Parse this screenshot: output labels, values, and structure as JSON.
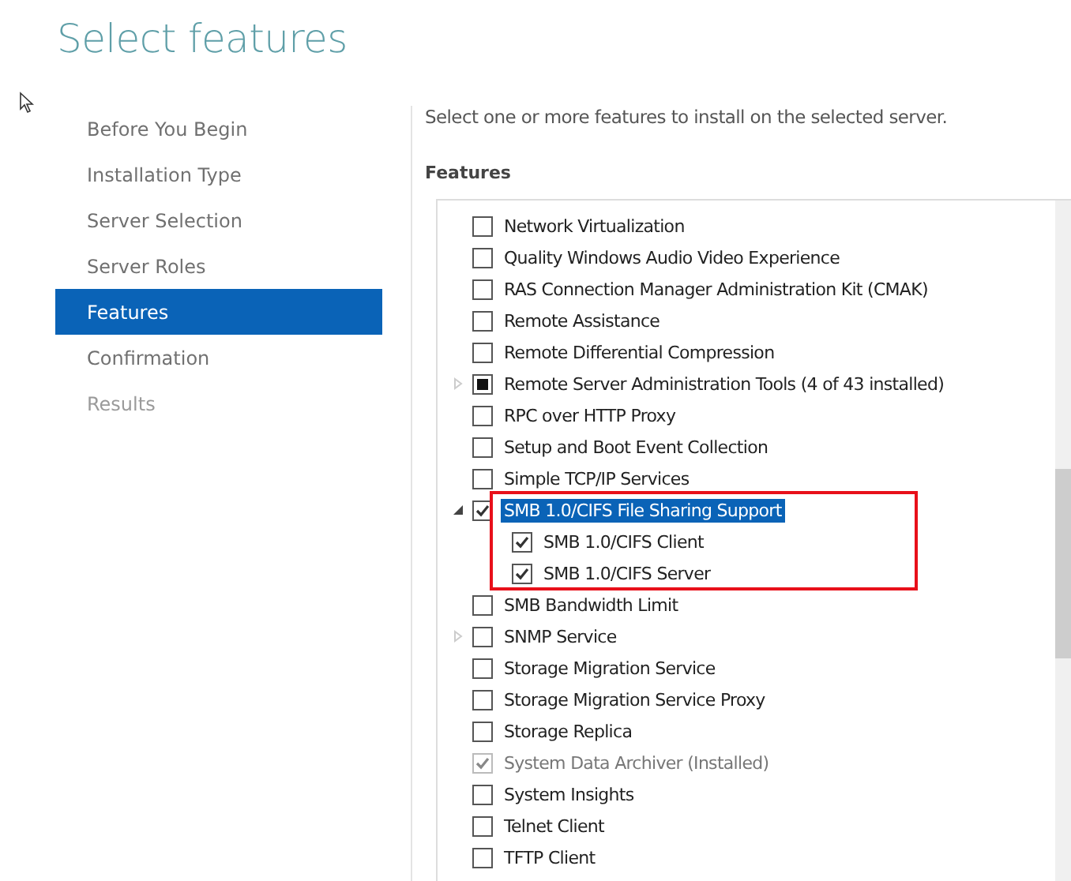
{
  "title": "Select features",
  "sidebar": {
    "items": [
      {
        "label": "Before You Begin",
        "selected": false,
        "disabled": false
      },
      {
        "label": "Installation Type",
        "selected": false,
        "disabled": false
      },
      {
        "label": "Server Selection",
        "selected": false,
        "disabled": false
      },
      {
        "label": "Server Roles",
        "selected": false,
        "disabled": false
      },
      {
        "label": "Features",
        "selected": true,
        "disabled": false
      },
      {
        "label": "Confirmation",
        "selected": false,
        "disabled": false
      },
      {
        "label": "Results",
        "selected": false,
        "disabled": true
      }
    ]
  },
  "description": "Select one or more features to install on the selected server.",
  "features_heading": "Features",
  "features": [
    {
      "label": "Network Virtualization",
      "checked": false,
      "disabled": false,
      "selected": false
    },
    {
      "label": "Quality Windows Audio Video Experience",
      "checked": false,
      "disabled": false,
      "selected": false
    },
    {
      "label": "RAS Connection Manager Administration Kit (CMAK)",
      "checked": false,
      "disabled": false,
      "selected": false
    },
    {
      "label": "Remote Assistance",
      "checked": false,
      "disabled": false,
      "selected": false
    },
    {
      "label": "Remote Differential Compression",
      "checked": false,
      "disabled": false,
      "selected": false
    },
    {
      "label": "Remote Server Administration Tools (4 of 43 installed)",
      "checked": false,
      "indeterminate": true,
      "disabled": false,
      "selected": false,
      "expanded": false
    },
    {
      "label": "RPC over HTTP Proxy",
      "checked": false,
      "disabled": false,
      "selected": false
    },
    {
      "label": "Setup and Boot Event Collection",
      "checked": false,
      "disabled": false,
      "selected": false
    },
    {
      "label": "Simple TCP/IP Services",
      "checked": false,
      "disabled": false,
      "selected": false
    },
    {
      "label": "SMB 1.0/CIFS File Sharing Support",
      "checked": true,
      "disabled": false,
      "selected": true,
      "expanded": true,
      "highlighted": true,
      "children": [
        {
          "label": "SMB 1.0/CIFS Client",
          "checked": true,
          "disabled": false,
          "selected": false
        },
        {
          "label": "SMB 1.0/CIFS Server",
          "checked": true,
          "disabled": false,
          "selected": false
        }
      ]
    },
    {
      "label": "SMB Bandwidth Limit",
      "checked": false,
      "disabled": false,
      "selected": false
    },
    {
      "label": "SNMP Service",
      "checked": false,
      "disabled": false,
      "selected": false,
      "expanded": false
    },
    {
      "label": "Storage Migration Service",
      "checked": false,
      "disabled": false,
      "selected": false
    },
    {
      "label": "Storage Migration Service Proxy",
      "checked": false,
      "disabled": false,
      "selected": false
    },
    {
      "label": "Storage Replica",
      "checked": false,
      "disabled": false,
      "selected": false
    },
    {
      "label": "System Data Archiver (Installed)",
      "checked": true,
      "disabled": true,
      "selected": false
    },
    {
      "label": "System Insights",
      "checked": false,
      "disabled": false,
      "selected": false
    },
    {
      "label": "Telnet Client",
      "checked": false,
      "disabled": false,
      "selected": false
    },
    {
      "label": "TFTP Client",
      "checked": false,
      "disabled": false,
      "selected": false
    }
  ]
}
